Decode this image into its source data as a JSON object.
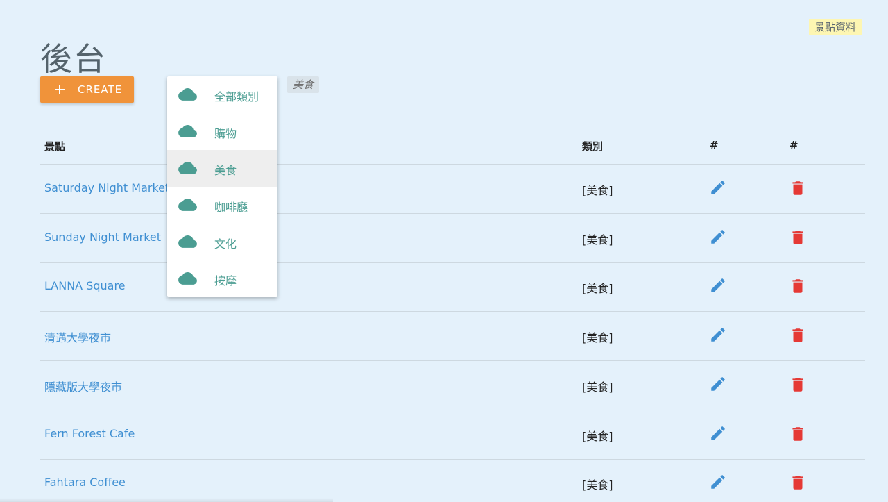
{
  "header": {
    "title": "後台",
    "section_badge": "景點資料"
  },
  "toolbar": {
    "create_label": "CREATE",
    "active_filter": "美食"
  },
  "dropdown": {
    "items": [
      {
        "label": "全部類別",
        "icon": "cloud-icon",
        "selected": false
      },
      {
        "label": "購物",
        "icon": "cloud-icon",
        "selected": false
      },
      {
        "label": "美食",
        "icon": "cloud-icon",
        "selected": true
      },
      {
        "label": "咖啡廳",
        "icon": "cloud-icon",
        "selected": false
      },
      {
        "label": "文化",
        "icon": "cloud-icon",
        "selected": false
      },
      {
        "label": "按摩",
        "icon": "cloud-icon",
        "selected": false
      }
    ]
  },
  "table": {
    "columns": [
      "景點",
      "類別",
      "#",
      "#"
    ],
    "rows": [
      {
        "name": "Saturday Night Market",
        "category": "[美食]"
      },
      {
        "name": "Sunday Night Market",
        "category": "[美食]"
      },
      {
        "name": "LANNA Square",
        "category": "[美食]"
      },
      {
        "name": "清邁大學夜市",
        "category": "[美食]"
      },
      {
        "name": "隱藏版大學夜市",
        "category": "[美食]"
      },
      {
        "name": "Fern Forest Cafe",
        "category": "[美食]"
      },
      {
        "name": "Fahtara Coffee",
        "category": "[美食]"
      }
    ],
    "row_icons": {
      "edit": "pencil-icon",
      "delete": "trash-icon"
    }
  },
  "colors": {
    "background": "#e4f1fb",
    "accent": "#f0933a",
    "link": "#3f8fd2",
    "edit_icon": "#3f8fd2",
    "delete_icon": "#e53935",
    "menu_text": "#4b9d92",
    "cloud_icon": "#4b9d92",
    "badge_bg": "#fdf6b2"
  }
}
